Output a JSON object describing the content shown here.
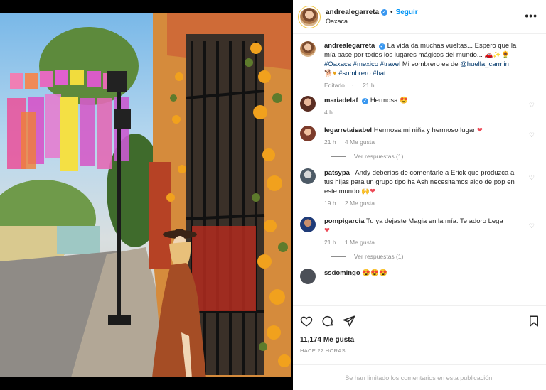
{
  "post": {
    "username": "andrealegarreta",
    "follow_label": "Seguir",
    "location": "Oaxaca",
    "more_label": "•••"
  },
  "caption": {
    "username": "andrealegarreta",
    "text": "La vida da muchas vueltas... Espero que la mía pase por todos los lugares mágicos del mundo...",
    "emojis": "🚗✨🌻",
    "tags": "#Oaxaca #mexico #travel",
    "text2": "Mi sombrero es de",
    "mention": "@huella_carmin",
    "emojis2": "🐕♥",
    "tags2": "#sombrero #hat",
    "edited": "Editado",
    "time": "21 h"
  },
  "comments": [
    {
      "username": "mariadelaf",
      "verified": true,
      "text": "Hermosa",
      "emoji": "😍",
      "time": "4 h",
      "likes": "",
      "replies": ""
    },
    {
      "username": "legarretaisabel",
      "verified": false,
      "text": "Hermosa mi niña y hermoso lugar",
      "emoji": "❤",
      "time": "21 h",
      "likes": "4 Me gusta",
      "replies": "Ver respuestas (1)"
    },
    {
      "username": "patsypa_",
      "verified": false,
      "text": "Andy deberías de comentarle a Erick que produzca a tus hijas para un grupo tipo ha Ash necesitamos algo de pop en este mundo",
      "emoji": "🙌",
      "time": "19 h",
      "likes": "2 Me gusta",
      "replies": ""
    },
    {
      "username": "pompigarcia",
      "verified": false,
      "text": "Tu ya dejaste Magia en la mía. Te adoro Lega",
      "emoji": "❤",
      "time": "21 h",
      "likes": "1 Me gusta",
      "replies": "Ver respuestas (1)"
    },
    {
      "username": "ssdomingo",
      "verified": false,
      "text": "",
      "emoji": "😍😍😍",
      "time": "",
      "likes": "",
      "replies": ""
    }
  ],
  "footer": {
    "likes_count": "11,174 Me gusta",
    "timestamp": "HACE 22 HORAS",
    "comments_limited": "Se han limitado los comentarios en esta publicación."
  },
  "icons": [
    "heart-icon",
    "comment-icon",
    "share-icon",
    "bookmark-icon",
    "verified-icon",
    "more-icon"
  ]
}
